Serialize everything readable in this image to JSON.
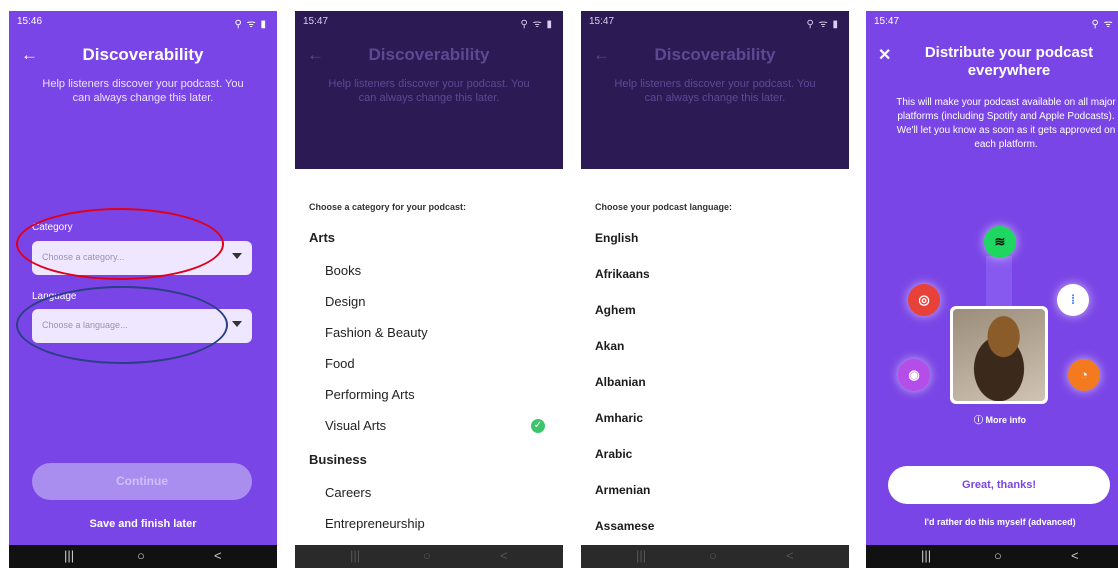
{
  "screens": {
    "s1": {
      "status_time": "15:46",
      "status_icons": "⚲ ᯤ ▮",
      "title": "Discoverability",
      "subtitle": "Help listeners discover your podcast. You can always change this later.",
      "category_label": "Category",
      "category_placeholder": "Choose a category...",
      "language_label": "Language",
      "language_placeholder": "Choose a language...",
      "continue": "Continue",
      "save_later": "Save and finish later"
    },
    "s2": {
      "status_time": "15:47",
      "title": "Discoverability",
      "subtitle": "Help listeners discover your podcast. You can always change this later.",
      "list_header": "Choose a category for your podcast:",
      "rows": [
        {
          "type": "group",
          "label": "Arts"
        },
        {
          "type": "item",
          "label": "Books"
        },
        {
          "type": "item",
          "label": "Design"
        },
        {
          "type": "item",
          "label": "Fashion & Beauty"
        },
        {
          "type": "item",
          "label": "Food"
        },
        {
          "type": "item",
          "label": "Performing Arts"
        },
        {
          "type": "item",
          "label": "Visual Arts",
          "selected": true
        },
        {
          "type": "group",
          "label": "Business"
        },
        {
          "type": "item",
          "label": "Careers"
        },
        {
          "type": "item",
          "label": "Entrepreneurship"
        }
      ]
    },
    "s3": {
      "status_time": "15:47",
      "title": "Discoverability",
      "subtitle": "Help listeners discover your podcast. You can always change this later.",
      "list_header": "Choose your podcast language:",
      "languages": [
        "English",
        "Afrikaans",
        "Aghem",
        "Akan",
        "Albanian",
        "Amharic",
        "Arabic",
        "Armenian",
        "Assamese"
      ]
    },
    "s4": {
      "status_time": "15:47",
      "title": "Distribute your podcast everywhere",
      "subtitle": "This will make your podcast available on all major platforms (including Spotify and Apple Podcasts). We'll let you know as soon as it gets approved on each platform.",
      "more_info": "More info",
      "great": "Great, thanks!",
      "advanced": "I'd rather do this myself (advanced)"
    }
  },
  "nav": {
    "recents": "|||",
    "home": "○",
    "back": "<"
  },
  "colors": {
    "purple": "#7a45e6",
    "spotify": "#1ed760",
    "pocketcasts": "#e8413a",
    "google": "#ffffff",
    "apple": "#b54de8",
    "castbox": "#f47a20"
  },
  "icons": [
    "back-arrow-icon",
    "caret-down-icon",
    "check-icon",
    "close-icon",
    "spotify-icon",
    "pocket-casts-icon",
    "google-podcasts-icon",
    "apple-podcasts-icon",
    "castbox-icon",
    "info-icon"
  ]
}
